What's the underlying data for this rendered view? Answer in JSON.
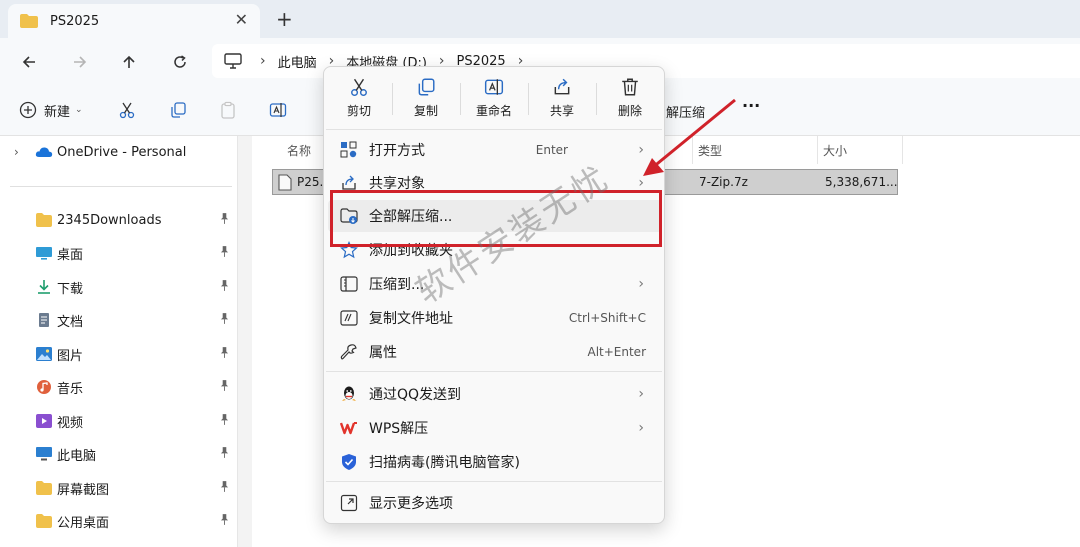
{
  "tab": {
    "title": "PS2025",
    "close": "✕",
    "new_tab": "+"
  },
  "breadcrumb": [
    "此电脑",
    "本地磁盘 (D:)",
    "PS2025"
  ],
  "toolbar": {
    "new_label": "新建"
  },
  "sidebar": {
    "onedrive": "OneDrive - Personal",
    "items": [
      {
        "label": "2345Downloads",
        "icon": "folder-icon",
        "color": "#f0c14b"
      },
      {
        "label": "桌面",
        "icon": "desktop-icon",
        "color": "#2f9bd6"
      },
      {
        "label": "下载",
        "icon": "download-icon",
        "color": "#1f9e6e"
      },
      {
        "label": "文档",
        "icon": "document-icon",
        "color": "#6b7b8f"
      },
      {
        "label": "图片",
        "icon": "pictures-icon",
        "color": "#2b7fd0"
      },
      {
        "label": "音乐",
        "icon": "music-icon",
        "color": "#e0603c"
      },
      {
        "label": "视频",
        "icon": "video-icon",
        "color": "#8a4fd0"
      },
      {
        "label": "此电脑",
        "icon": "computer-icon",
        "color": "#2b7fd0"
      },
      {
        "label": "屏幕截图",
        "icon": "folder-icon",
        "color": "#f0c14b"
      },
      {
        "label": "公用桌面",
        "icon": "folder-icon",
        "color": "#f0c14b"
      }
    ]
  },
  "columns": {
    "name": "名称",
    "type": "类型",
    "size": "大小"
  },
  "file": {
    "name": "P25.",
    "type": "7-Zip.7z",
    "size": "5,338,671..."
  },
  "context_menu": {
    "quick_actions": [
      "剪切",
      "复制",
      "重命名",
      "共享",
      "删除"
    ],
    "items": [
      {
        "label": "打开方式",
        "shortcut": "Enter",
        "submenu": true
      },
      {
        "label": "共享对象",
        "shortcut": "",
        "submenu": true
      },
      {
        "label": "全部解压缩...",
        "shortcut": "",
        "submenu": false
      },
      {
        "label": "添加到收藏夹",
        "shortcut": "",
        "submenu": false
      },
      {
        "label": "压缩到...",
        "shortcut": "",
        "submenu": true
      },
      {
        "label": "复制文件地址",
        "shortcut": "Ctrl+Shift+C",
        "submenu": false
      },
      {
        "label": "属性",
        "shortcut": "Alt+Enter",
        "submenu": false
      },
      {
        "label": "通过QQ发送到",
        "shortcut": "",
        "submenu": true
      },
      {
        "label": "WPS解压",
        "shortcut": "",
        "submenu": true
      },
      {
        "label": "扫描病毒(腾讯电脑管家)",
        "shortcut": "",
        "submenu": false
      },
      {
        "label": "显示更多选项",
        "shortcut": "",
        "submenu": false
      }
    ],
    "chevron": "›",
    "behind_label": "解压缩"
  },
  "watermark": "软件安装无忧",
  "accent_color": "#d0222a"
}
